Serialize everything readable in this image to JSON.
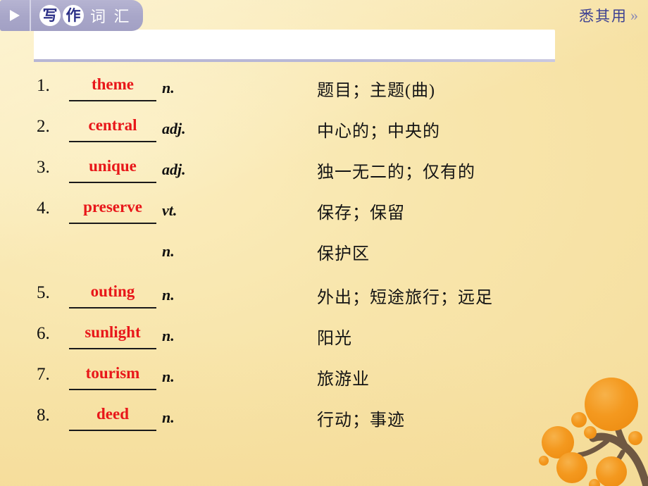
{
  "header": {
    "arrow_icon": "play-triangle-icon",
    "tab_chars_circled": [
      "写",
      "作"
    ],
    "tab_chars_plain": "词 汇",
    "right_label": "悉其用",
    "right_chevron": "»"
  },
  "colors": {
    "background": "#f8e5ab",
    "tab_purple": "#a9a7c9",
    "word_red": "#e8171a",
    "header_text_blue": "#3d4192",
    "tree_leaf": "#f29824",
    "tree_branch": "#6f5842"
  },
  "entries": [
    {
      "num": "1.",
      "word": "theme",
      "pos": "n.",
      "meaning": "题目；主题(曲)"
    },
    {
      "num": "2.",
      "word": "central",
      "pos": "adj.",
      "meaning": "中心的；中央的"
    },
    {
      "num": "3.",
      "word": "unique",
      "pos": "adj.",
      "meaning": "独一无二的；仅有的"
    },
    {
      "num": "4.",
      "word": "preserve",
      "pos": "vt.",
      "meaning": "保存；保留"
    },
    {
      "num": "",
      "word": "",
      "pos": "n.",
      "meaning": "保护区"
    },
    {
      "num": "5.",
      "word": "outing",
      "pos": "n.",
      "meaning": "外出；短途旅行；远足"
    },
    {
      "num": "6.",
      "word": "sunlight",
      "pos": "n.",
      "meaning": "阳光"
    },
    {
      "num": "7.",
      "word": "tourism",
      "pos": "n.",
      "meaning": "旅游业"
    },
    {
      "num": "8.",
      "word": "deed",
      "pos": "n.",
      "meaning": "行动；事迹"
    }
  ]
}
